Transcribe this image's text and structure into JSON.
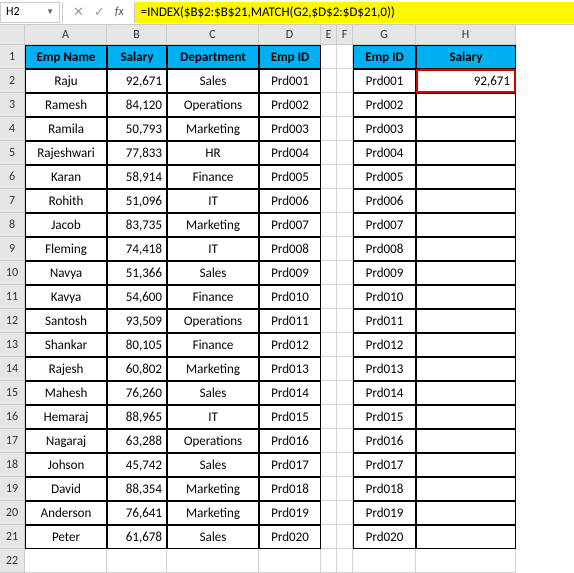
{
  "namebox": "H2",
  "formula": "=INDEX($B$2:$B$21,MATCH(G2,$D$2:$D$21,0))",
  "columns": [
    "A",
    "B",
    "C",
    "D",
    "E",
    "F",
    "G",
    "H"
  ],
  "table1_headers": {
    "a": "Emp Name",
    "b": "Salary",
    "c": "Department",
    "d": "Emp ID"
  },
  "table2_headers": {
    "g": "Emp ID",
    "h": "Salary"
  },
  "table1": [
    {
      "a": "Raju",
      "b": "92,671",
      "c": "Sales",
      "d": "Prd001"
    },
    {
      "a": "Ramesh",
      "b": "84,120",
      "c": "Operations",
      "d": "Prd002"
    },
    {
      "a": "Ramila",
      "b": "50,793",
      "c": "Marketing",
      "d": "Prd003"
    },
    {
      "a": "Rajeshwari",
      "b": "77,833",
      "c": "HR",
      "d": "Prd004"
    },
    {
      "a": "Karan",
      "b": "58,914",
      "c": "Finance",
      "d": "Prd005"
    },
    {
      "a": "Rohith",
      "b": "51,096",
      "c": "IT",
      "d": "Prd006"
    },
    {
      "a": "Jacob",
      "b": "83,735",
      "c": "Marketing",
      "d": "Prd007"
    },
    {
      "a": "Fleming",
      "b": "74,418",
      "c": "IT",
      "d": "Prd008"
    },
    {
      "a": "Navya",
      "b": "51,366",
      "c": "Sales",
      "d": "Prd009"
    },
    {
      "a": "Kavya",
      "b": "54,600",
      "c": "Finance",
      "d": "Prd010"
    },
    {
      "a": "Santosh",
      "b": "93,509",
      "c": "Operations",
      "d": "Prd011"
    },
    {
      "a": "Shankar",
      "b": "80,105",
      "c": "Finance",
      "d": "Prd012"
    },
    {
      "a": "Rajesh",
      "b": "60,802",
      "c": "Marketing",
      "d": "Prd013"
    },
    {
      "a": "Mahesh",
      "b": "76,260",
      "c": "Sales",
      "d": "Prd014"
    },
    {
      "a": "Hemaraj",
      "b": "88,965",
      "c": "IT",
      "d": "Prd015"
    },
    {
      "a": "Nagaraj",
      "b": "63,288",
      "c": "Operations",
      "d": "Prd016"
    },
    {
      "a": "Johson",
      "b": "45,742",
      "c": "Sales",
      "d": "Prd017"
    },
    {
      "a": "David",
      "b": "88,354",
      "c": "Marketing",
      "d": "Prd018"
    },
    {
      "a": "Anderson",
      "b": "76,641",
      "c": "Marketing",
      "d": "Prd019"
    },
    {
      "a": "Peter",
      "b": "61,678",
      "c": "Sales",
      "d": "Prd020"
    }
  ],
  "table2": [
    {
      "g": "Prd001",
      "h": "92,671"
    },
    {
      "g": "Prd002",
      "h": ""
    },
    {
      "g": "Prd003",
      "h": ""
    },
    {
      "g": "Prd004",
      "h": ""
    },
    {
      "g": "Prd005",
      "h": ""
    },
    {
      "g": "Prd006",
      "h": ""
    },
    {
      "g": "Prd007",
      "h": ""
    },
    {
      "g": "Prd008",
      "h": ""
    },
    {
      "g": "Prd009",
      "h": ""
    },
    {
      "g": "Prd010",
      "h": ""
    },
    {
      "g": "Prd011",
      "h": ""
    },
    {
      "g": "Prd012",
      "h": ""
    },
    {
      "g": "Prd013",
      "h": ""
    },
    {
      "g": "Prd014",
      "h": ""
    },
    {
      "g": "Prd015",
      "h": ""
    },
    {
      "g": "Prd016",
      "h": ""
    },
    {
      "g": "Prd017",
      "h": ""
    },
    {
      "g": "Prd018",
      "h": ""
    },
    {
      "g": "Prd019",
      "h": ""
    },
    {
      "g": "Prd020",
      "h": ""
    }
  ],
  "max_row": 22
}
